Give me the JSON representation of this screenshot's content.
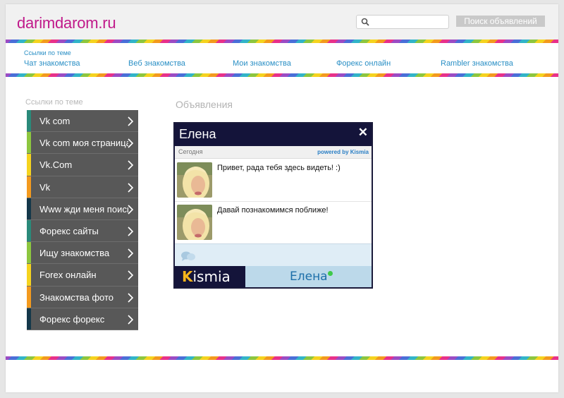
{
  "header": {
    "logo": "darimdarom.ru",
    "search_placeholder": "",
    "search_button": "Поиск объявлений"
  },
  "topnav": {
    "caption": "Ссылки по теме",
    "links": [
      "Чат знакомства",
      "Веб знакомства",
      "Мои знакомства",
      "Форекс онлайн",
      "Rambler знакомства"
    ]
  },
  "sidebar": {
    "caption": "Ссылки по теме",
    "items": [
      {
        "label": "Vk com",
        "color": "#2a8a7a"
      },
      {
        "label": "Vk com моя страница",
        "color": "#8dc63f"
      },
      {
        "label": "Vk.Com",
        "color": "#f5d31f"
      },
      {
        "label": "Vk",
        "color": "#f39a1e"
      },
      {
        "label": "Www жди меня поиск",
        "color": "#14384a"
      },
      {
        "label": "Форекс сайты",
        "color": "#2a8a7a"
      },
      {
        "label": "Ищу знакомства",
        "color": "#8dc63f"
      },
      {
        "label": "Forex онлайн",
        "color": "#f5d31f"
      },
      {
        "label": "Знакомства фото",
        "color": "#f39a1e"
      },
      {
        "label": "Форекс форекс",
        "color": "#14384a"
      }
    ]
  },
  "main": {
    "ads_title": "Объявления"
  },
  "chat": {
    "name": "Елена",
    "close": "✕",
    "today": "Сегодня",
    "powered": "powered by Kismia",
    "messages": [
      {
        "text": "Привет, рада тебя здесь видеть! :)"
      },
      {
        "text": "Давай познакомимся поближе!"
      }
    ],
    "brand_initial": "K",
    "brand_rest": "ismia",
    "tab_name": "Елена",
    "online_color": "#3ec94a"
  }
}
